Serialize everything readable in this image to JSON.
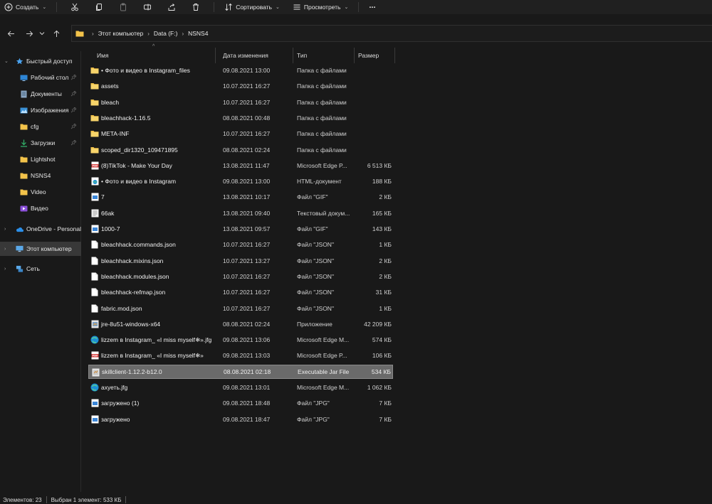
{
  "toolbar": {
    "create_label": "Создать",
    "sort_label": "Сортировать",
    "view_label": "Просмотреть",
    "more_label": "..."
  },
  "breadcrumb": [
    "Этот компьютер",
    "Data (F:)",
    "NSNS4"
  ],
  "sidebar": {
    "quick_access": "Быстрый доступ",
    "items": [
      {
        "label": "Рабочий стол",
        "icon": "desktop-icon",
        "pinned": true
      },
      {
        "label": "Документы",
        "icon": "documents-icon",
        "pinned": true
      },
      {
        "label": "Изображения",
        "icon": "pictures-icon",
        "pinned": true
      },
      {
        "label": "cfg",
        "icon": "folder-icon",
        "pinned": true
      },
      {
        "label": "Загрузки",
        "icon": "downloads-icon",
        "pinned": true
      },
      {
        "label": "Lightshot",
        "icon": "folder-icon",
        "pinned": false
      },
      {
        "label": "NSNS4",
        "icon": "folder-icon",
        "pinned": false
      },
      {
        "label": "Video",
        "icon": "folder-icon",
        "pinned": false
      },
      {
        "label": "Видео",
        "icon": "videos-icon",
        "pinned": false
      }
    ],
    "onedrive": "OneDrive - Personal",
    "this_pc": "Этот компьютер",
    "network": "Сеть"
  },
  "columns": {
    "name": "Имя",
    "date": "Дата изменения",
    "type": "Тип",
    "size": "Размер"
  },
  "files": [
    {
      "name": "• Фото и видео в Instagram_files",
      "date": "09.08.2021 13:00",
      "type": "Папка с файлами",
      "size": "",
      "icon": "folder"
    },
    {
      "name": "assets",
      "date": "10.07.2021 16:27",
      "type": "Папка с файлами",
      "size": "",
      "icon": "folder"
    },
    {
      "name": "bleach",
      "date": "10.07.2021 16:27",
      "type": "Папка с файлами",
      "size": "",
      "icon": "folder"
    },
    {
      "name": "bleachhack-1.16.5",
      "date": "08.08.2021 00:48",
      "type": "Папка с файлами",
      "size": "",
      "icon": "folder"
    },
    {
      "name": "META-INF",
      "date": "10.07.2021 16:27",
      "type": "Папка с файлами",
      "size": "",
      "icon": "folder"
    },
    {
      "name": "scoped_dir1320_109471895",
      "date": "08.08.2021 02:24",
      "type": "Папка с файлами",
      "size": "",
      "icon": "folder"
    },
    {
      "name": "(8)TikTok - Make Your Day",
      "date": "13.08.2021 11:47",
      "type": "Microsoft Edge P...",
      "size": "6 513 КБ",
      "icon": "pdf"
    },
    {
      "name": "• Фото и видео в Instagram",
      "date": "09.08.2021 13:00",
      "type": "HTML-документ",
      "size": "188 КБ",
      "icon": "html"
    },
    {
      "name": "7",
      "date": "13.08.2021 10:17",
      "type": "Файл \"GIF\"",
      "size": "2 КБ",
      "icon": "image"
    },
    {
      "name": "66ak",
      "date": "13.08.2021 09:40",
      "type": "Текстовый докум...",
      "size": "165 КБ",
      "icon": "text"
    },
    {
      "name": "1000-7",
      "date": "13.08.2021 09:57",
      "type": "Файл \"GIF\"",
      "size": "143 КБ",
      "icon": "image"
    },
    {
      "name": "bleachhack.commands.json",
      "date": "10.07.2021 16:27",
      "type": "Файл \"JSON\"",
      "size": "1 КБ",
      "icon": "file"
    },
    {
      "name": "bleachhack.mixins.json",
      "date": "10.07.2021 13:27",
      "type": "Файл \"JSON\"",
      "size": "2 КБ",
      "icon": "file"
    },
    {
      "name": "bleachhack.modules.json",
      "date": "10.07.2021 16:27",
      "type": "Файл \"JSON\"",
      "size": "2 КБ",
      "icon": "file"
    },
    {
      "name": "bleachhack-refmap.json",
      "date": "10.07.2021 16:27",
      "type": "Файл \"JSON\"",
      "size": "31 КБ",
      "icon": "file"
    },
    {
      "name": "fabric.mod.json",
      "date": "10.07.2021 16:27",
      "type": "Файл \"JSON\"",
      "size": "1 КБ",
      "icon": "file"
    },
    {
      "name": "jre-8u51-windows-x64",
      "date": "08.08.2021 02:24",
      "type": "Приложение",
      "size": "42 209 КБ",
      "icon": "app"
    },
    {
      "name": "lizzem в Instagram_ «I miss myself❄».jfg",
      "date": "09.08.2021 13:06",
      "type": "Microsoft Edge M...",
      "size": "574 КБ",
      "icon": "edge"
    },
    {
      "name": "lizzem в Instagram_ «I miss myself❄»",
      "date": "09.08.2021 13:03",
      "type": "Microsoft Edge P...",
      "size": "106 КБ",
      "icon": "pdf"
    },
    {
      "name": "skillclient-1.12.2-b12.0",
      "date": "08.08.2021 02:18",
      "type": "Executable Jar File",
      "size": "534 КБ",
      "icon": "jar",
      "selected": true
    },
    {
      "name": "ахуеть.jfg",
      "date": "09.08.2021 13:01",
      "type": "Microsoft Edge M...",
      "size": "1 062 КБ",
      "icon": "edge"
    },
    {
      "name": "загружено (1)",
      "date": "09.08.2021 18:48",
      "type": "Файл \"JPG\"",
      "size": "7 КБ",
      "icon": "image"
    },
    {
      "name": "загружено",
      "date": "09.08.2021 18:47",
      "type": "Файл \"JPG\"",
      "size": "7 КБ",
      "icon": "image"
    }
  ],
  "status": {
    "count": "Элементов: 23",
    "selection": "Выбран 1 элемент: 533 КБ"
  },
  "colors": {
    "folder": "#f3c34a",
    "accent": "#4aa3f0",
    "pdf_red": "#d63b3b",
    "edge_blue": "#1c8fd6"
  }
}
